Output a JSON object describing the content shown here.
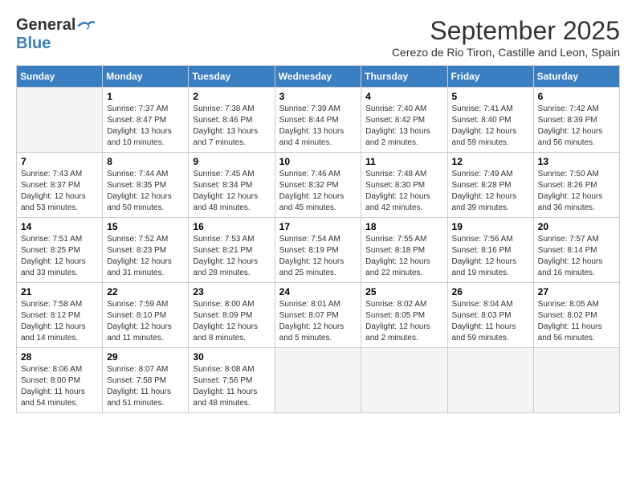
{
  "logo": {
    "line1": "General",
    "line2": "Blue"
  },
  "title": "September 2025",
  "subtitle": "Cerezo de Rio Tiron, Castille and Leon, Spain",
  "headers": [
    "Sunday",
    "Monday",
    "Tuesday",
    "Wednesday",
    "Thursday",
    "Friday",
    "Saturday"
  ],
  "weeks": [
    [
      {
        "day": "",
        "info": ""
      },
      {
        "day": "1",
        "info": "Sunrise: 7:37 AM\nSunset: 8:47 PM\nDaylight: 13 hours\nand 10 minutes."
      },
      {
        "day": "2",
        "info": "Sunrise: 7:38 AM\nSunset: 8:46 PM\nDaylight: 13 hours\nand 7 minutes."
      },
      {
        "day": "3",
        "info": "Sunrise: 7:39 AM\nSunset: 8:44 PM\nDaylight: 13 hours\nand 4 minutes."
      },
      {
        "day": "4",
        "info": "Sunrise: 7:40 AM\nSunset: 8:42 PM\nDaylight: 13 hours\nand 2 minutes."
      },
      {
        "day": "5",
        "info": "Sunrise: 7:41 AM\nSunset: 8:40 PM\nDaylight: 12 hours\nand 59 minutes."
      },
      {
        "day": "6",
        "info": "Sunrise: 7:42 AM\nSunset: 8:39 PM\nDaylight: 12 hours\nand 56 minutes."
      }
    ],
    [
      {
        "day": "7",
        "info": "Sunrise: 7:43 AM\nSunset: 8:37 PM\nDaylight: 12 hours\nand 53 minutes."
      },
      {
        "day": "8",
        "info": "Sunrise: 7:44 AM\nSunset: 8:35 PM\nDaylight: 12 hours\nand 50 minutes."
      },
      {
        "day": "9",
        "info": "Sunrise: 7:45 AM\nSunset: 8:34 PM\nDaylight: 12 hours\nand 48 minutes."
      },
      {
        "day": "10",
        "info": "Sunrise: 7:46 AM\nSunset: 8:32 PM\nDaylight: 12 hours\nand 45 minutes."
      },
      {
        "day": "11",
        "info": "Sunrise: 7:48 AM\nSunset: 8:30 PM\nDaylight: 12 hours\nand 42 minutes."
      },
      {
        "day": "12",
        "info": "Sunrise: 7:49 AM\nSunset: 8:28 PM\nDaylight: 12 hours\nand 39 minutes."
      },
      {
        "day": "13",
        "info": "Sunrise: 7:50 AM\nSunset: 8:26 PM\nDaylight: 12 hours\nand 36 minutes."
      }
    ],
    [
      {
        "day": "14",
        "info": "Sunrise: 7:51 AM\nSunset: 8:25 PM\nDaylight: 12 hours\nand 33 minutes."
      },
      {
        "day": "15",
        "info": "Sunrise: 7:52 AM\nSunset: 8:23 PM\nDaylight: 12 hours\nand 31 minutes."
      },
      {
        "day": "16",
        "info": "Sunrise: 7:53 AM\nSunset: 8:21 PM\nDaylight: 12 hours\nand 28 minutes."
      },
      {
        "day": "17",
        "info": "Sunrise: 7:54 AM\nSunset: 8:19 PM\nDaylight: 12 hours\nand 25 minutes."
      },
      {
        "day": "18",
        "info": "Sunrise: 7:55 AM\nSunset: 8:18 PM\nDaylight: 12 hours\nand 22 minutes."
      },
      {
        "day": "19",
        "info": "Sunrise: 7:56 AM\nSunset: 8:16 PM\nDaylight: 12 hours\nand 19 minutes."
      },
      {
        "day": "20",
        "info": "Sunrise: 7:57 AM\nSunset: 8:14 PM\nDaylight: 12 hours\nand 16 minutes."
      }
    ],
    [
      {
        "day": "21",
        "info": "Sunrise: 7:58 AM\nSunset: 8:12 PM\nDaylight: 12 hours\nand 14 minutes."
      },
      {
        "day": "22",
        "info": "Sunrise: 7:59 AM\nSunset: 8:10 PM\nDaylight: 12 hours\nand 11 minutes."
      },
      {
        "day": "23",
        "info": "Sunrise: 8:00 AM\nSunset: 8:09 PM\nDaylight: 12 hours\nand 8 minutes."
      },
      {
        "day": "24",
        "info": "Sunrise: 8:01 AM\nSunset: 8:07 PM\nDaylight: 12 hours\nand 5 minutes."
      },
      {
        "day": "25",
        "info": "Sunrise: 8:02 AM\nSunset: 8:05 PM\nDaylight: 12 hours\nand 2 minutes."
      },
      {
        "day": "26",
        "info": "Sunrise: 8:04 AM\nSunset: 8:03 PM\nDaylight: 11 hours\nand 59 minutes."
      },
      {
        "day": "27",
        "info": "Sunrise: 8:05 AM\nSunset: 8:02 PM\nDaylight: 11 hours\nand 56 minutes."
      }
    ],
    [
      {
        "day": "28",
        "info": "Sunrise: 8:06 AM\nSunset: 8:00 PM\nDaylight: 11 hours\nand 54 minutes."
      },
      {
        "day": "29",
        "info": "Sunrise: 8:07 AM\nSunset: 7:58 PM\nDaylight: 11 hours\nand 51 minutes."
      },
      {
        "day": "30",
        "info": "Sunrise: 8:08 AM\nSunset: 7:56 PM\nDaylight: 11 hours\nand 48 minutes."
      },
      {
        "day": "",
        "info": ""
      },
      {
        "day": "",
        "info": ""
      },
      {
        "day": "",
        "info": ""
      },
      {
        "day": "",
        "info": ""
      }
    ]
  ]
}
